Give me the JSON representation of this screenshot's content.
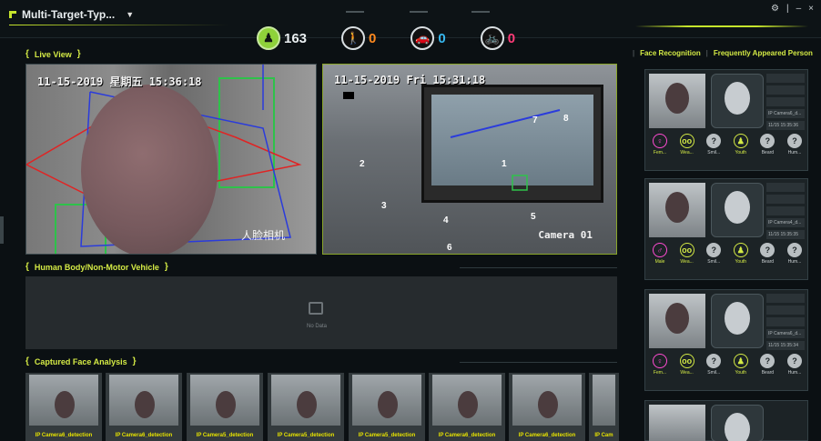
{
  "app": {
    "title": "Multi-Target-Typ..."
  },
  "counters": {
    "person": "163",
    "pedestrian": "0",
    "vehicle": "0",
    "non_motor": "0"
  },
  "window": {
    "settings": "⚙",
    "separator": "|",
    "minimize": "–",
    "close": "×"
  },
  "sections": {
    "live_view": "Live View",
    "human_body": "Human Body/Non-Motor Vehicle",
    "captured_face": "Captured Face Analysis"
  },
  "live": {
    "left_osd": "11-15-2019 星期五 15:36:18",
    "left_cam": "人脸相机",
    "right_osd": "11-15-2019 Fri 15:31:18",
    "right_cam": "Camera 01"
  },
  "human_body": {
    "no_data": "No Data"
  },
  "captures": [
    {
      "label": "IP Camera6_detection"
    },
    {
      "label": "IP Camera6_detection"
    },
    {
      "label": "IP Camera5_detection"
    },
    {
      "label": "IP Camera5_detection"
    },
    {
      "label": "IP Camera5_detection"
    },
    {
      "label": "IP Camera6_detection"
    },
    {
      "label": "IP Camera6_detection"
    },
    {
      "label": "IP Cam"
    }
  ],
  "right_panel": {
    "tab_face": "Face Recognition",
    "tab_sep": "|",
    "tab_frequent": "Frequently Appeared Person"
  },
  "fr_cards": [
    {
      "camera": "IP Camera6_d...",
      "time": "11/15 15:35:36",
      "attrs": [
        {
          "icon": "♀",
          "label": "Fem...",
          "type": "gen-f"
        },
        {
          "icon": "oo",
          "label": "Wea...",
          "type": "glasses"
        },
        {
          "icon": "?",
          "label": "Smil...",
          "type": "gray"
        },
        {
          "icon": "♟",
          "label": "Youth",
          "type": "youth"
        },
        {
          "icon": "?",
          "label": "Beard",
          "type": "gray"
        },
        {
          "icon": "?",
          "label": "Hum...",
          "type": "gray"
        }
      ]
    },
    {
      "camera": "IP Camera4_d...",
      "time": "11/15 15:35:35",
      "attrs": [
        {
          "icon": "♂",
          "label": "Male",
          "type": "gen-m"
        },
        {
          "icon": "oo",
          "label": "Wea...",
          "type": "glasses"
        },
        {
          "icon": "?",
          "label": "Smil...",
          "type": "gray"
        },
        {
          "icon": "♟",
          "label": "Youth",
          "type": "youth"
        },
        {
          "icon": "?",
          "label": "Beard",
          "type": "gray"
        },
        {
          "icon": "?",
          "label": "Hum...",
          "type": "gray"
        }
      ]
    },
    {
      "camera": "IP Camera6_d...",
      "time": "11/15 15:35:34",
      "attrs": [
        {
          "icon": "♀",
          "label": "Fem...",
          "type": "gen-f"
        },
        {
          "icon": "oo",
          "label": "Wea...",
          "type": "glasses"
        },
        {
          "icon": "?",
          "label": "Smil...",
          "type": "gray"
        },
        {
          "icon": "♟",
          "label": "Youth",
          "type": "youth"
        },
        {
          "icon": "?",
          "label": "Beard",
          "type": "gray"
        },
        {
          "icon": "?",
          "label": "Hum...",
          "type": "gray"
        }
      ]
    }
  ]
}
